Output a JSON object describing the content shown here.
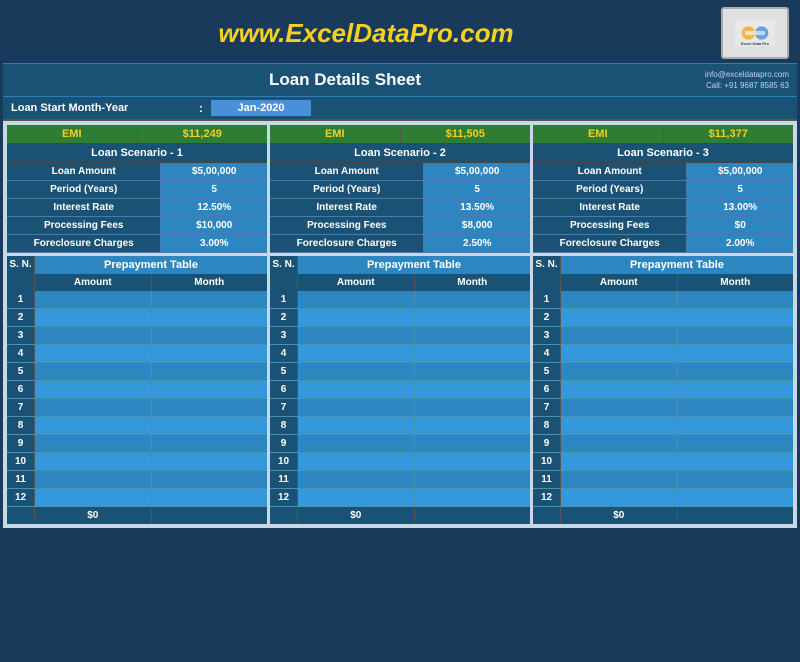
{
  "header": {
    "website": "www.ExcelDataPro.com",
    "sheet_title": "Loan Details Sheet",
    "contact_email": "info@exceldatapro.com",
    "contact_phone": "Call: +91 9687 8585 63",
    "logo_lines": [
      "Excel",
      "Data",
      "Pro"
    ]
  },
  "loan_start": {
    "label": "Loan Start Month-Year",
    "colon": ":",
    "value": "Jan-2020"
  },
  "scenarios": [
    {
      "emi_label": "EMI",
      "emi_value": "$11,249",
      "title": "Loan Scenario - 1",
      "rows": [
        {
          "label": "Loan Amount",
          "value": "$5,00,000"
        },
        {
          "label": "Period (Years)",
          "value": "5"
        },
        {
          "label": "Interest Rate",
          "value": "12.50%"
        },
        {
          "label": "Processing Fees",
          "value": "$10,000"
        },
        {
          "label": "Foreclosure Charges",
          "value": "3.00%"
        }
      ]
    },
    {
      "emi_label": "EMI",
      "emi_value": "$11,505",
      "title": "Loan Scenario - 2",
      "rows": [
        {
          "label": "Loan Amount",
          "value": "$5,00,000"
        },
        {
          "label": "Period (Years)",
          "value": "5"
        },
        {
          "label": "Interest Rate",
          "value": "13.50%"
        },
        {
          "label": "Processing Fees",
          "value": "$8,000"
        },
        {
          "label": "Foreclosure Charges",
          "value": "2.50%"
        }
      ]
    },
    {
      "emi_label": "EMI",
      "emi_value": "$11,377",
      "title": "Loan Scenario - 3",
      "rows": [
        {
          "label": "Loan Amount",
          "value": "$5,00,000"
        },
        {
          "label": "Period (Years)",
          "value": "5"
        },
        {
          "label": "Interest Rate",
          "value": "13.00%"
        },
        {
          "label": "Processing Fees",
          "value": "$0"
        },
        {
          "label": "Foreclosure Charges",
          "value": "2.00%"
        }
      ]
    }
  ],
  "prepayment": {
    "title": "Prepayment Table",
    "sn_label": "S. N.",
    "amount_label": "Amount",
    "month_label": "Month",
    "rows": [
      1,
      2,
      3,
      4,
      5,
      6,
      7,
      8,
      9,
      10,
      11,
      12
    ],
    "total_label": "$0"
  }
}
